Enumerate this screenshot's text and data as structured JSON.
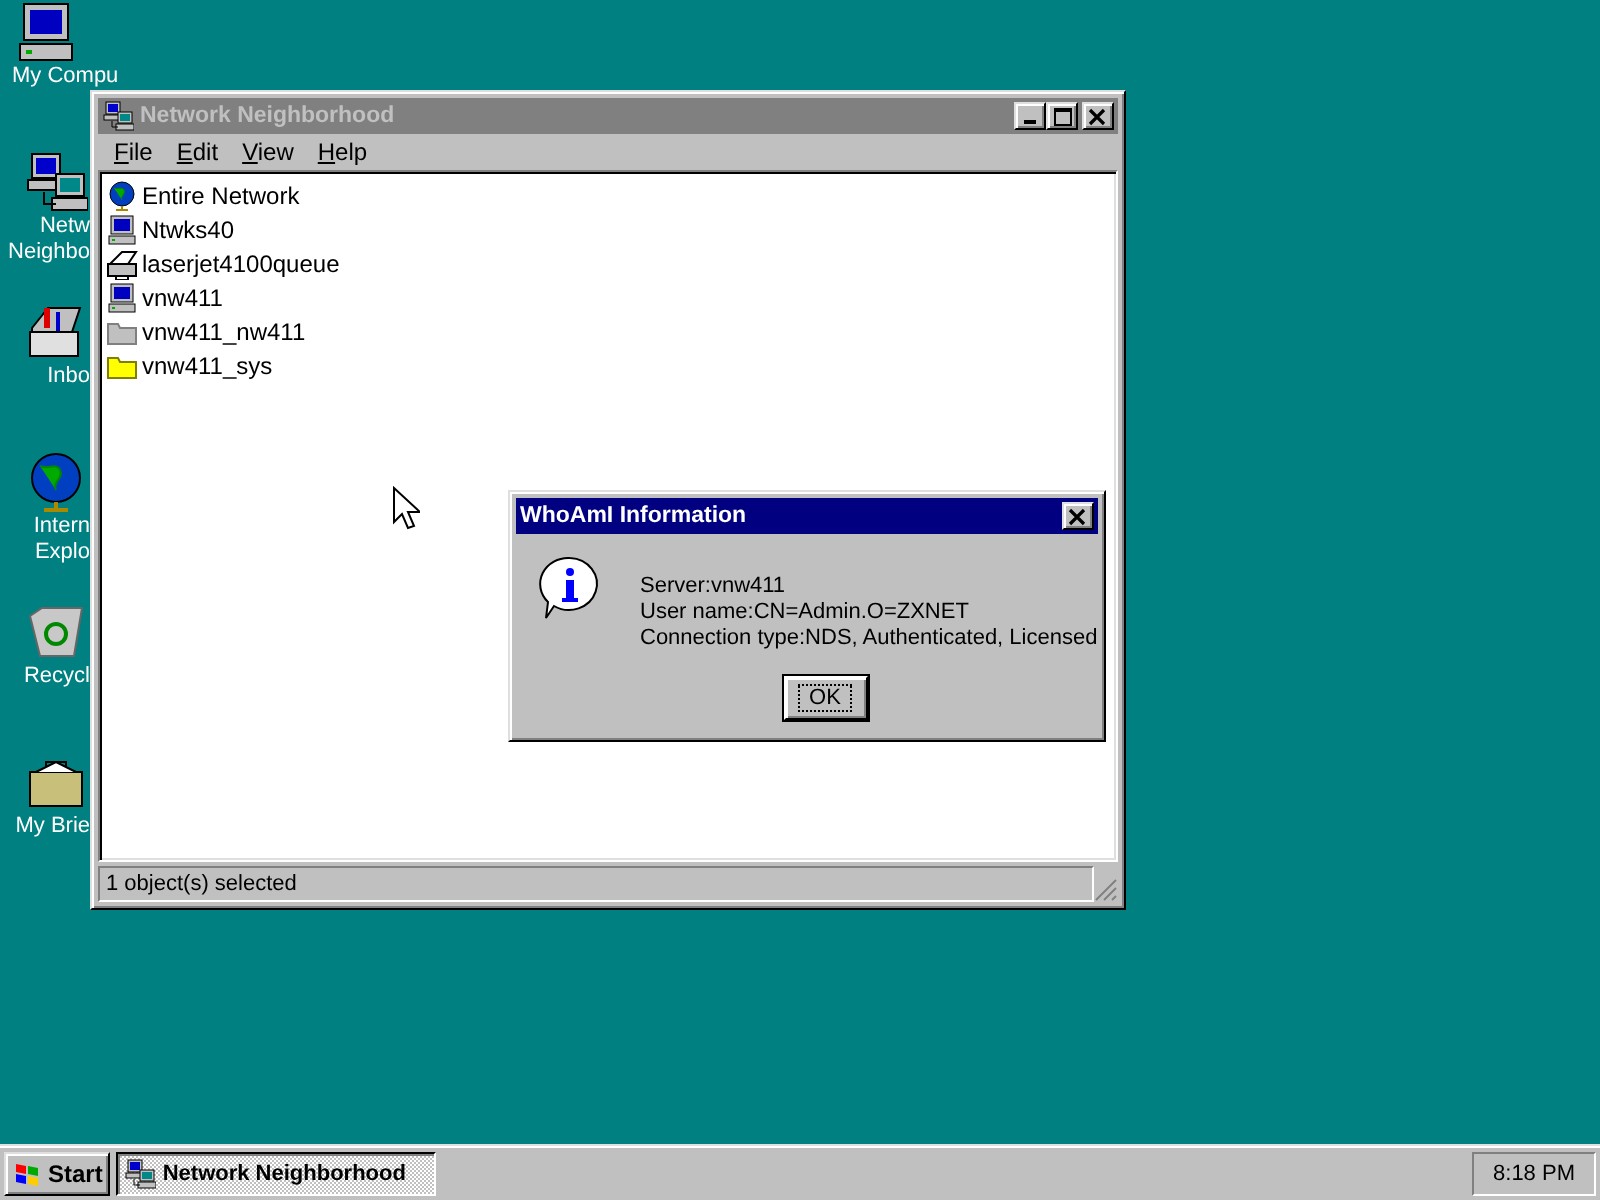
{
  "desktop_icons": [
    {
      "kind": "computer",
      "label": [
        "My Compu"
      ]
    },
    {
      "kind": "network",
      "label": [
        "Netw",
        "Neighbo"
      ]
    },
    {
      "kind": "inbox",
      "label": [
        "Inbo"
      ]
    },
    {
      "kind": "globe",
      "label": [
        "Intern",
        "Explo"
      ]
    },
    {
      "kind": "recycle",
      "label": [
        "Recycl"
      ]
    },
    {
      "kind": "briefcase",
      "label": [
        "My Brie"
      ]
    }
  ],
  "window": {
    "title": "Network Neighborhood",
    "active": false,
    "menu": [
      {
        "hot": "F",
        "rest": "ile"
      },
      {
        "hot": "E",
        "rest": "dit"
      },
      {
        "hot": "V",
        "rest": "iew"
      },
      {
        "hot": "H",
        "rest": "elp"
      }
    ],
    "items": [
      {
        "kind": "globe",
        "label": "Entire Network"
      },
      {
        "kind": "computer",
        "label": "Ntwks40"
      },
      {
        "kind": "printer",
        "label": "laserjet4100queue"
      },
      {
        "kind": "computer",
        "label": "vnw411"
      },
      {
        "kind": "volume",
        "label": "vnw411_nw411"
      },
      {
        "kind": "folder",
        "label": "vnw411_sys"
      }
    ],
    "status_bar": "1 object(s) selected"
  },
  "dialog": {
    "title": "WhoAmI Information",
    "active": true,
    "lines": [
      "Server:vnw411",
      "User name:CN=Admin.O=ZXNET",
      "Connection type:NDS, Authenticated, Licensed"
    ],
    "button": {
      "label": "OK",
      "focused": true
    }
  },
  "taskbar": {
    "start": "Start",
    "tasks": [
      {
        "label": "Network Neighborhood",
        "selected": true
      }
    ],
    "clock": "8:18 PM"
  }
}
